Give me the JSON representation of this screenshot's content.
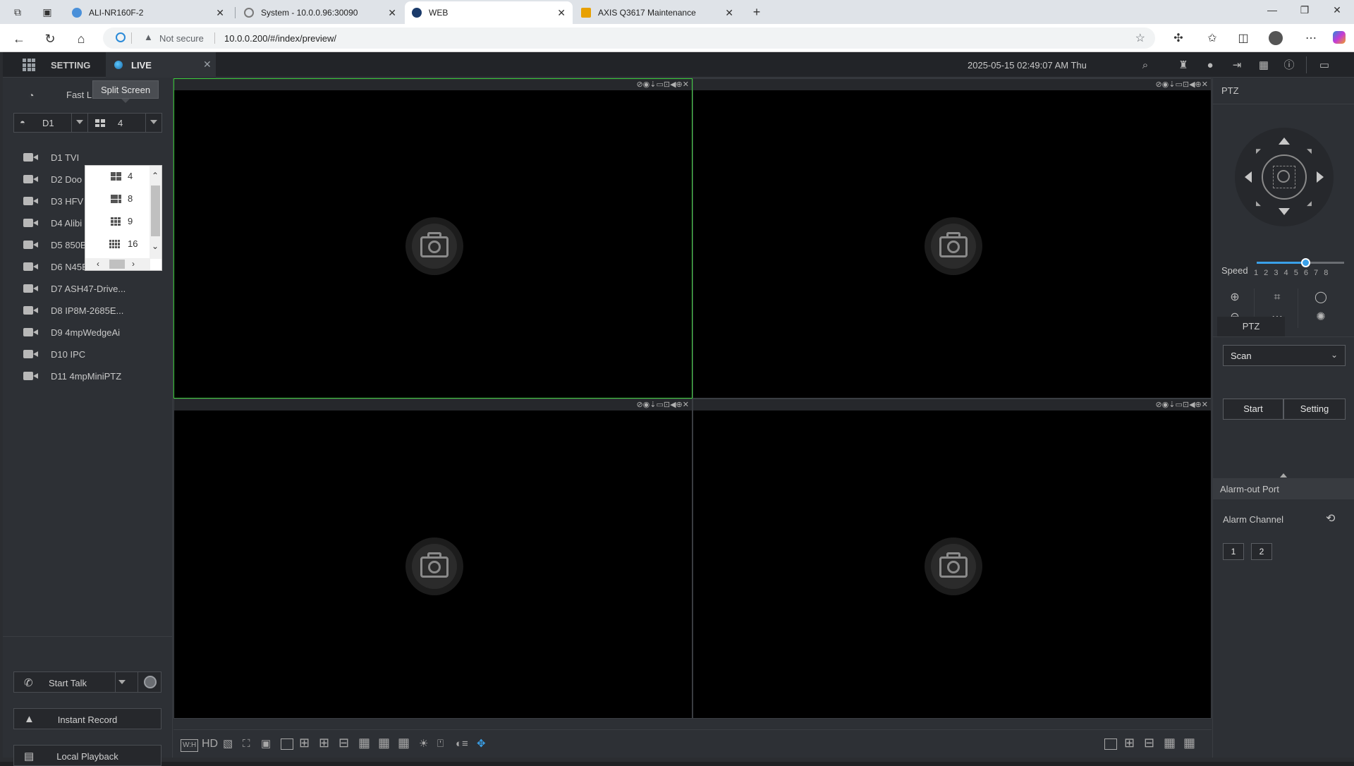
{
  "browser": {
    "tabs": [
      {
        "title": "ALI-NR160F-2",
        "favicon_color": "#4a90d9"
      },
      {
        "title": "System - 10.0.0.96:30090",
        "favicon_color": "#7a7a7a"
      },
      {
        "title": "WEB",
        "favicon_color": "#1a3a6a"
      },
      {
        "title": "AXIS Q3617 Maintenance",
        "favicon_color": "#e8a000"
      }
    ],
    "security_label": "Not secure",
    "url": "10.0.0.200/#/index/preview/"
  },
  "topnav": {
    "setting_label": "SETTING",
    "live_label": "LIVE",
    "datetime": "2025-05-15 02:49:07 AM Thu"
  },
  "left": {
    "fast_live_label": "Fast Live",
    "tooltip": "Split Screen",
    "device_select": "D1",
    "split_select": "4",
    "split_options": [
      "4",
      "8",
      "9",
      "16"
    ],
    "cameras": [
      "D1 TVI",
      "D2 Doo",
      "D3 HFV",
      "D4 Alibi",
      "D5 850Back20x",
      "D6 N45EFN2",
      "D7 ASH47-Drive...",
      "D8 IP8M-2685E...",
      "D9 4mpWedgeAi",
      "D10 IPC",
      "D11 4mpMiniPTZ"
    ],
    "start_talk": "Start Talk",
    "instant_record": "Instant Record",
    "local_playback": "Local Playback"
  },
  "video": {
    "bottom_hd": "HD",
    "pane_tools": "⊘◉⇣▭⊡◀⊕✕"
  },
  "right": {
    "ptz_title": "PTZ",
    "speed_label": "Speed",
    "speed_values": "1 2 3 4 5 6 7 8",
    "speed_level": 5,
    "ptz_tab": "PTZ",
    "mode_select": "Scan",
    "start_button": "Start",
    "setting_button": "Setting",
    "alarm_section": "Alarm-out Port",
    "alarm_channel_label": "Alarm Channel",
    "alarm_channels": [
      "1",
      "2"
    ]
  },
  "colors": {
    "accent": "#3aa0e8",
    "active_pane_border": "#3ccf3c"
  }
}
